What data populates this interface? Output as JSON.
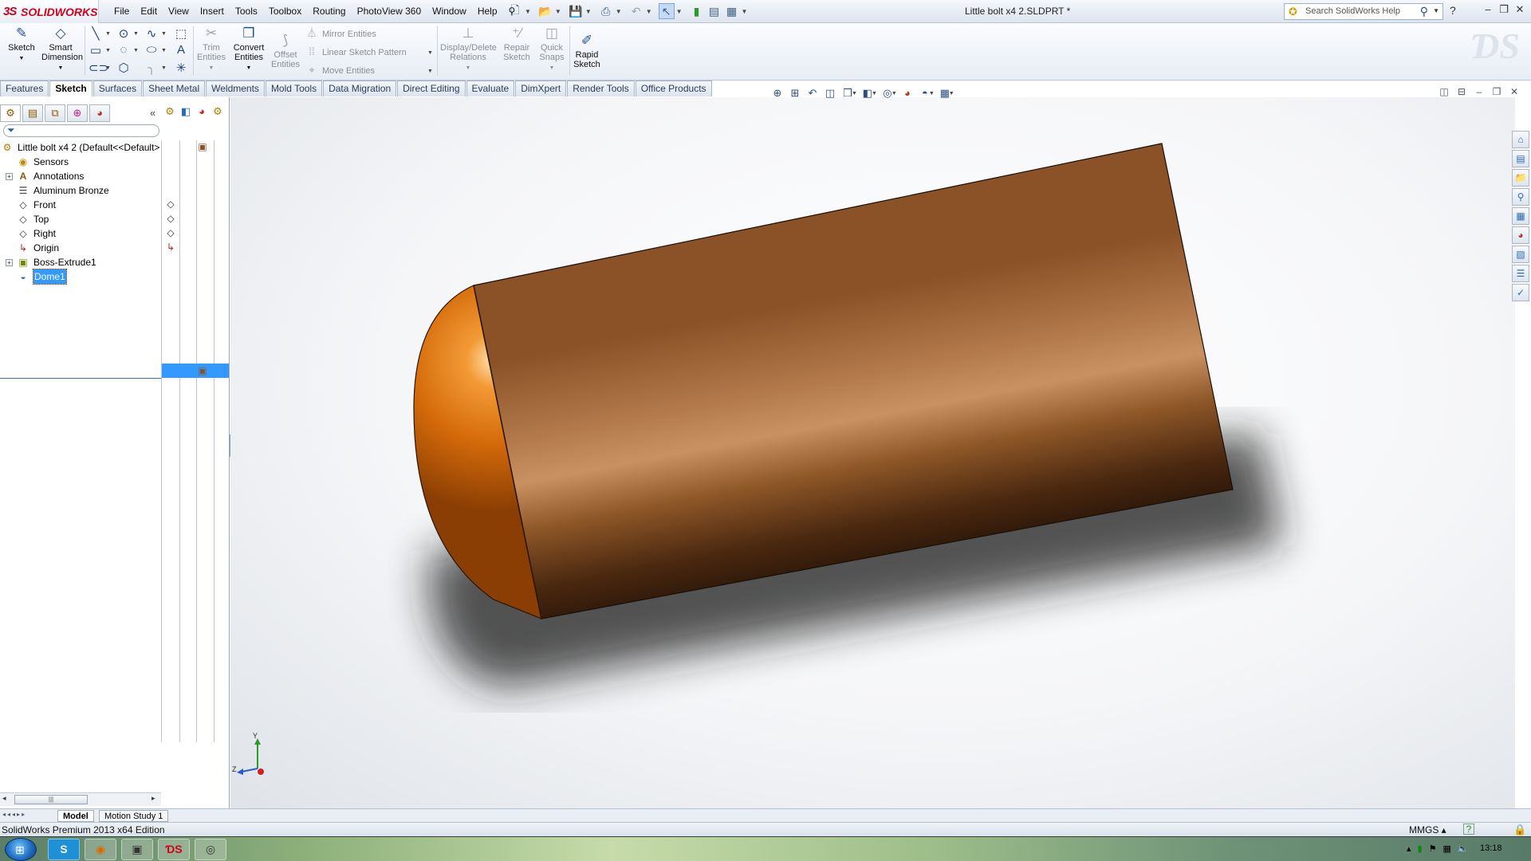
{
  "app": {
    "brand_mark": "3S",
    "brand_name": "SOLIDWORKS",
    "document_title": "Little bolt x4 2.SLDPRT *",
    "search_placeholder": "Search SolidWorks Help"
  },
  "menu": [
    "File",
    "Edit",
    "View",
    "Insert",
    "Tools",
    "Toolbox",
    "Routing",
    "PhotoView 360",
    "Window",
    "Help"
  ],
  "command_manager": {
    "sketch": "Sketch",
    "smart_dimension_1": "Smart",
    "smart_dimension_2": "Dimension",
    "trim_1": "Trim",
    "trim_2": "Entities",
    "convert_1": "Convert",
    "convert_2": "Entities",
    "offset_1": "Offset",
    "offset_2": "Entities",
    "mirror": "Mirror Entities",
    "linear_pattern": "Linear Sketch Pattern",
    "move": "Move Entities",
    "display_delete_1": "Display/Delete",
    "display_delete_2": "Relations",
    "repair_1": "Repair",
    "repair_2": "Sketch",
    "quick_snaps_1": "Quick",
    "quick_snaps_2": "Snaps",
    "rapid_1": "Rapid",
    "rapid_2": "Sketch"
  },
  "tabs": [
    "Features",
    "Sketch",
    "Surfaces",
    "Sheet Metal",
    "Weldments",
    "Mold Tools",
    "Data Migration",
    "Direct Editing",
    "Evaluate",
    "DimXpert",
    "Render Tools",
    "Office Products"
  ],
  "active_tab": "Sketch",
  "feature_tree": {
    "root": "Little bolt x4 2  (Default<<Default>",
    "items": [
      {
        "label": "Sensors",
        "icon": "sensor-icon"
      },
      {
        "label": "Annotations",
        "icon": "annotations-icon"
      },
      {
        "label": "Aluminum Bronze",
        "icon": "material-icon"
      },
      {
        "label": "Front",
        "icon": "plane-icon"
      },
      {
        "label": "Top",
        "icon": "plane-icon"
      },
      {
        "label": "Right",
        "icon": "plane-icon"
      },
      {
        "label": "Origin",
        "icon": "origin-icon"
      },
      {
        "label": "Boss-Extrude1",
        "icon": "extrude-icon"
      },
      {
        "label": "Dome1",
        "icon": "dome-icon"
      }
    ],
    "selected": "Dome1"
  },
  "bottom_tabs": [
    "Model",
    "Motion Study 1"
  ],
  "status": {
    "edition": "SolidWorks Premium 2013 x64 Edition",
    "units": "MMGS",
    "help": "?"
  },
  "triad": {
    "y": "Y",
    "z": "Z"
  },
  "taskbar": {
    "time": "13:18",
    "skype": "S"
  },
  "colors": {
    "bronze_light": "#c99162",
    "bronze_mid": "#8a5226",
    "bronze_dark": "#1a0d04",
    "dome_orange": "#e07a10",
    "selection": "#3399ff",
    "brand_red": "#d0021b"
  }
}
